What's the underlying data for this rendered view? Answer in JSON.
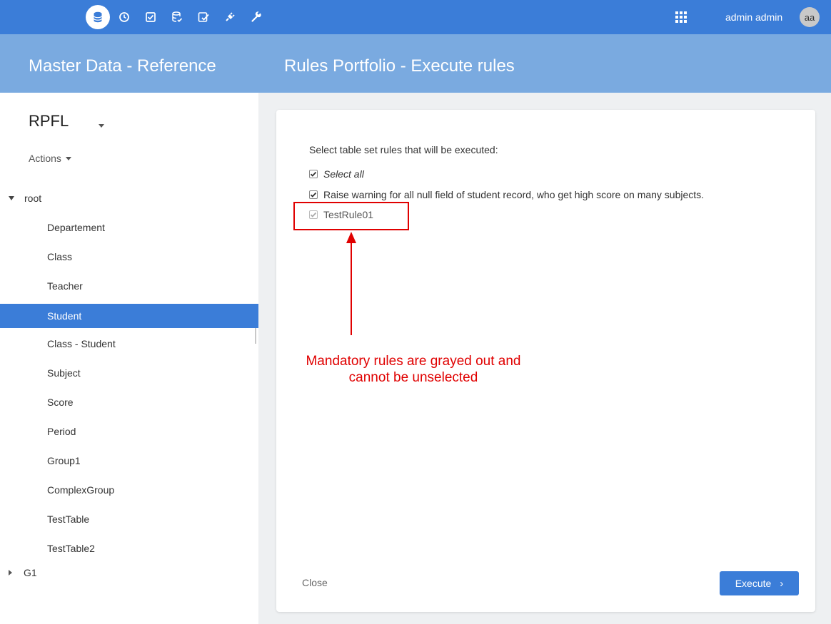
{
  "topbar": {
    "nav_icons": [
      {
        "name": "database-icon",
        "active": true
      },
      {
        "name": "clock-icon",
        "active": false
      },
      {
        "name": "checkbox-icon",
        "active": false
      },
      {
        "name": "database-check-icon",
        "active": false
      },
      {
        "name": "checklist-icon",
        "active": false
      },
      {
        "name": "plug-icon",
        "active": false
      },
      {
        "name": "wrench-icon",
        "active": false
      }
    ],
    "apps_icon": "grid-icon",
    "user_name": "admin admin",
    "avatar_initials": "aa"
  },
  "subbar": {
    "left_title": "Master Data - Reference",
    "right_title": "Rules Portfolio - Execute rules"
  },
  "sidebar": {
    "entity": "RPFL",
    "actions_label": "Actions",
    "tree": {
      "root_label": "root",
      "items": [
        {
          "label": "Departement",
          "selected": false
        },
        {
          "label": "Class",
          "selected": false
        },
        {
          "label": "Teacher",
          "selected": false
        },
        {
          "label": "Student",
          "selected": true
        },
        {
          "label": "Class - Student",
          "selected": false
        },
        {
          "label": "Subject",
          "selected": false
        },
        {
          "label": "Score",
          "selected": false
        },
        {
          "label": "Period",
          "selected": false
        },
        {
          "label": "Group1",
          "selected": false
        },
        {
          "label": "ComplexGroup",
          "selected": false
        },
        {
          "label": "TestTable",
          "selected": false
        },
        {
          "label": "TestTable2",
          "selected": false
        }
      ],
      "collapsed_label": "G1"
    }
  },
  "panel": {
    "instructions": "Select table set rules that will be executed:",
    "rules": [
      {
        "label": "Select all",
        "checked": true,
        "disabled": false
      },
      {
        "label": "Raise warning for all null field of student record, who get high score on many subjects.",
        "checked": true,
        "disabled": false
      },
      {
        "label": "TestRule01",
        "checked": true,
        "disabled": true
      }
    ],
    "close_label": "Close",
    "execute_label": "Execute"
  },
  "annotation": {
    "line1": "Mandatory rules are grayed out and",
    "line2": "cannot be unselected"
  },
  "colors": {
    "primary": "#3b7dd8",
    "subheader": "#7aaae0",
    "annotation": "#e00000"
  }
}
